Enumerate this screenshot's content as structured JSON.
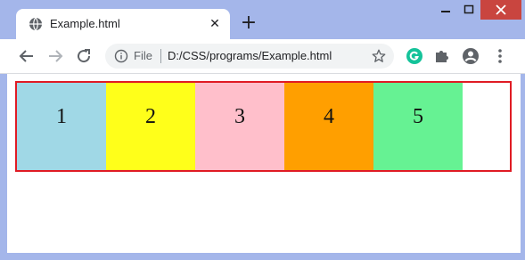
{
  "browser": {
    "tab": {
      "title": "Example.html"
    },
    "new_tab_label": "+",
    "tab_close_label": "✕",
    "address_bar": {
      "scheme_label": "File",
      "url": "D:/CSS/programs/Example.html"
    },
    "icons": {
      "favicon": "globe-icon",
      "back": "arrow-left-icon",
      "forward": "arrow-right-icon",
      "reload": "reload-icon",
      "info": "info-icon",
      "bookmark": "star-icon",
      "grammarly": "grammarly-icon",
      "extensions": "puzzle-icon",
      "profile": "profile-icon",
      "menu": "kebab-menu-icon"
    },
    "colors": {
      "frame": "#a4b6ea",
      "close_button": "#c9453f",
      "grammarly": "#15c39a"
    }
  },
  "page": {
    "container_border_color": "#e01b24",
    "items": [
      {
        "label": "1",
        "color": "#a0d8e6"
      },
      {
        "label": "2",
        "color": "#ffff1a"
      },
      {
        "label": "3",
        "color": "#ffbfcb"
      },
      {
        "label": "4",
        "color": "#ff9f00"
      },
      {
        "label": "5",
        "color": "#66f293"
      }
    ]
  }
}
